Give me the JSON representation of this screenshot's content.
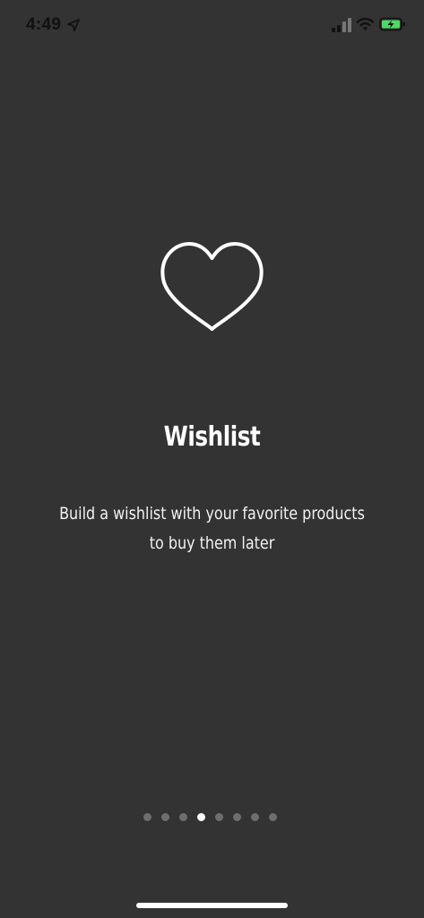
{
  "status_bar": {
    "time": "4:49",
    "icons": [
      "location-arrow-icon",
      "cellular-signal-icon",
      "wifi-icon",
      "battery-charging-icon"
    ],
    "battery_color": "#4cd964"
  },
  "slide": {
    "icon": "heart-outline-icon",
    "title": "Wishlist",
    "description": "Build a wishlist with your favorite products to buy them later"
  },
  "pagination": {
    "total": 8,
    "current": 4
  },
  "colors": {
    "background": "#333333",
    "text": "#ffffff",
    "dot_inactive": "#6e6e6e",
    "dot_active": "#ffffff"
  }
}
